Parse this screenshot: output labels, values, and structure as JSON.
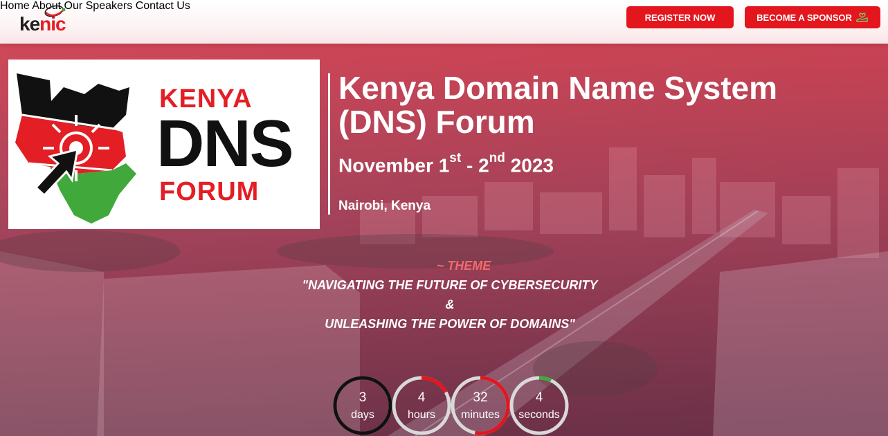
{
  "header": {
    "logo": {
      "part1": "ke",
      "part2": "nic"
    },
    "nav": [
      "Home",
      "About",
      "Our Speakers",
      "Contact Us"
    ],
    "register_label": "REGISTER NOW",
    "sponsor_label": "BECOME A SPONSOR",
    "sponsor_icon": "hand-heart-icon",
    "colors": {
      "accent": "#e3161e"
    }
  },
  "poster": {
    "line1": "KENYA",
    "line2": "DNS",
    "line3": "FORUM",
    "colors": {
      "red": "#e31e24",
      "green": "#41a93c",
      "black": "#111111"
    }
  },
  "event": {
    "title": "Kenya Domain Name System (DNS) Forum",
    "date": {
      "start_day": "November 1",
      "start_suffix": "st",
      "separator": " - 2",
      "end_suffix": "nd",
      "year": " 2023"
    },
    "location": "Nairobi, Kenya"
  },
  "theme": {
    "label": "~ THEME",
    "line1": "\"NAVIGATING THE FUTURE OF CYBERSECURITY",
    "line2": "&",
    "line3": "UNLEASHING THE POWER OF DOMAINS\""
  },
  "countdown": [
    {
      "value": "3",
      "unit": "days",
      "progress": 1.0,
      "color": "#111111"
    },
    {
      "value": "4",
      "unit": "hours",
      "progress": 0.17,
      "color": "#e3161e"
    },
    {
      "value": "32",
      "unit": "minutes",
      "progress": 0.53,
      "color": "#e3161e"
    },
    {
      "value": "4",
      "unit": "seconds",
      "progress": 0.07,
      "color": "#41a93c"
    }
  ]
}
